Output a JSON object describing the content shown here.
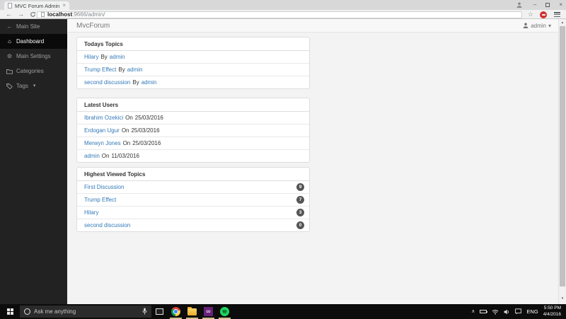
{
  "browser": {
    "tab_title": "MVC Forum Admin",
    "url_host": "localhost",
    "url_path": ":9666/admin/"
  },
  "glyphs": {
    "back": "←",
    "forward": "→",
    "star": "☆",
    "tab_close": "×",
    "minimize": "–",
    "window_close": "×",
    "home": "⌂",
    "gears": "⚙",
    "caret_down": "▾",
    "chevron_up": "∧",
    "vs_infinity": "∞",
    "scroll_up": "▲",
    "scroll_down": "▼"
  },
  "sidebar": {
    "items": [
      {
        "label": "Main Site"
      },
      {
        "label": "Dashboard"
      },
      {
        "label": "Main Settings"
      },
      {
        "label": "Categories"
      },
      {
        "label": "Tags"
      }
    ]
  },
  "header": {
    "brand": "MvcForum",
    "user": "admin"
  },
  "panels": {
    "todays_topics": {
      "title": "Todays Topics",
      "items": [
        {
          "topic": "Hilary",
          "by_label": "By",
          "author": "admin"
        },
        {
          "topic": "Trump Effect",
          "by_label": "By",
          "author": "admin"
        },
        {
          "topic": "second discussion",
          "by_label": "By",
          "author": "admin"
        }
      ]
    },
    "latest_users": {
      "title": "Latest Users",
      "items": [
        {
          "name": "Ibrahim Ozekici",
          "on_label": "On",
          "date": "25/03/2016"
        },
        {
          "name": "Erdogan Ugur",
          "on_label": "On",
          "date": "25/03/2016"
        },
        {
          "name": "Merwyn Jones",
          "on_label": "On",
          "date": "25/03/2016"
        },
        {
          "name": "admin",
          "on_label": "On",
          "date": "11/03/2016"
        }
      ]
    },
    "highest_viewed_topics": {
      "title": "Highest Viewed Topics",
      "items": [
        {
          "topic": "First Discussion",
          "views": "9"
        },
        {
          "topic": "Trump Effect",
          "views": "7"
        },
        {
          "topic": "Hilary",
          "views": "3"
        },
        {
          "topic": "second discussion",
          "views": "0"
        }
      ]
    }
  },
  "taskbar": {
    "search_placeholder": "Ask me anything",
    "language": "ENG",
    "time": "5:50 PM",
    "date": "4/4/2016"
  },
  "colors": {
    "link": "#337ab7",
    "sidebar_bg": "#222222",
    "badge_bg": "#555555",
    "taskbar_bg": "#0c0c0c"
  }
}
